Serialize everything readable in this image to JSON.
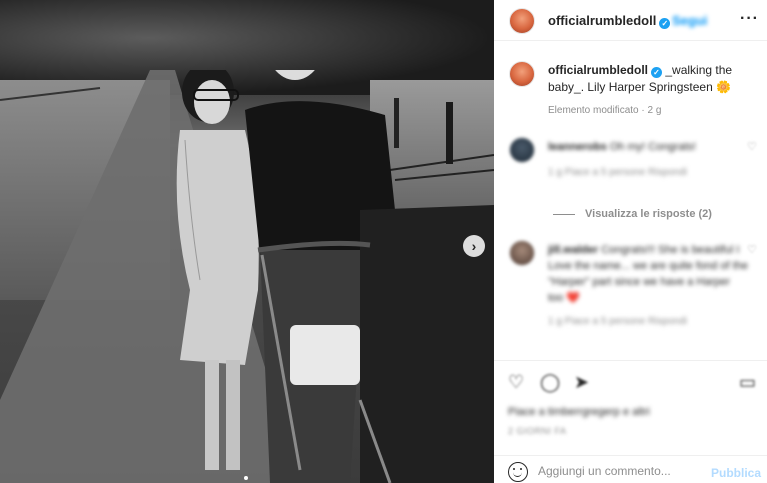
{
  "post": {
    "username": "officialrumbledoll",
    "follow_label": "Segui",
    "more_icon": "more-horizontal-icon",
    "caption": {
      "username": "officialrumbledoll",
      "text": "_walking the baby_. Lily Harper Springsteen 🌼",
      "meta": "Elemento modificato · 2 g"
    }
  },
  "comments": [
    {
      "username": "leannerobs",
      "text": "Oh my! Congrats!",
      "meta": "1 g   Piace a 5 persone   Rispondi"
    },
    {
      "username": "jill.walder",
      "text": "Congrats!!! She is beautiful I Love the name... we are quite fond of the \"Harper\" part since we have a Harper too ❤️",
      "meta": "1 g   Piace a 5 persone   Rispondi"
    }
  ],
  "view_replies_label": "Visualizza le risposte (2)",
  "likes_text": "Piace a timberrgregerp e altri",
  "date_text": "2 GIORNI FA",
  "compose": {
    "placeholder": "Aggiungi un commento...",
    "post_label": "Pubblica"
  },
  "icons": {
    "next": "chevron-right-icon",
    "like": "heart-icon",
    "comment": "comment-icon",
    "share": "share-icon",
    "save": "bookmark-icon",
    "emoji": "emoji-icon",
    "verified": "verified-badge-icon"
  },
  "colors": {
    "accent": "#0095f6",
    "verified": "#1da1f2",
    "muted": "#8e8e8e",
    "post_disabled": "#b3dbff"
  }
}
